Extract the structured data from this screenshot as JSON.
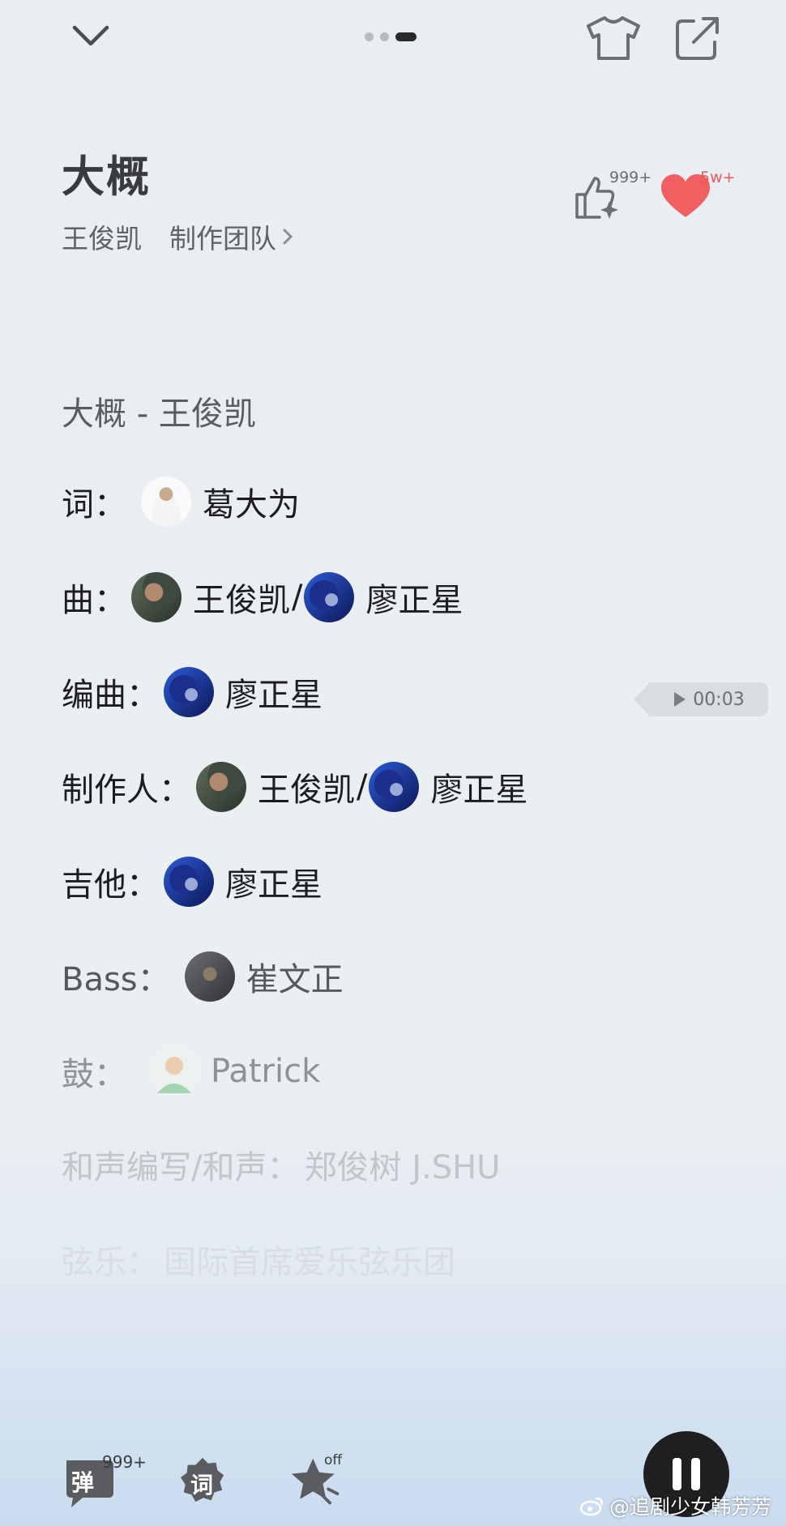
{
  "header": {
    "collapse_icon": "chevron-down-icon",
    "page_indicator": {
      "count": 3,
      "active": 3
    },
    "skin_icon": "tshirt-icon",
    "share_icon": "share-icon"
  },
  "song": {
    "title": "大概",
    "artist": "王俊凯",
    "team_link": "制作团队",
    "like_count": "999+",
    "favorite_count": "5w+"
  },
  "credits": {
    "title_line": "大概 - 王俊凯",
    "lyricist": {
      "role": "词：",
      "names": [
        "葛大为"
      ]
    },
    "composer": {
      "role": "曲：",
      "names": [
        "王俊凯",
        "廖正星"
      ],
      "sep": "/"
    },
    "arranger": {
      "role": "编曲：",
      "names": [
        "廖正星"
      ]
    },
    "producer": {
      "role": "制作人：",
      "names": [
        "王俊凯",
        "廖正星"
      ],
      "sep": "/"
    },
    "guitar": {
      "role": "吉他：",
      "names": [
        "廖正星"
      ]
    },
    "bass": {
      "role": "Bass：",
      "names": [
        "崔文正"
      ]
    },
    "drums": {
      "role": "鼓：",
      "names": [
        "Patrick"
      ]
    },
    "harmony": {
      "role": "和声编写/和声：",
      "names": [
        "郑俊树 J.SHU"
      ]
    },
    "strings": {
      "role": "弦乐：",
      "names": [
        "国际首席爱乐弦乐团"
      ]
    }
  },
  "timer": {
    "time": "00:03"
  },
  "bottom_bar": {
    "danmaku_label": "弹",
    "danmaku_count": "999+",
    "lyrics_label": "词",
    "effect_badge": "off"
  },
  "watermark": "@追剧少女韩芳芳",
  "colors": {
    "heart": "#f06060",
    "play_button": "#1f1f21"
  }
}
